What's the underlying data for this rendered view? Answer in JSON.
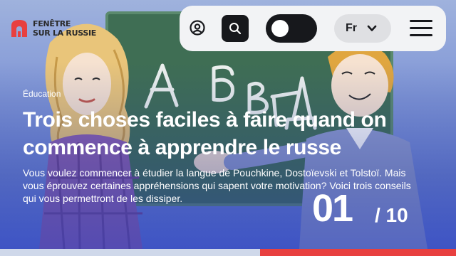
{
  "header": {
    "logo_line1": "Fenêtre",
    "logo_line2": "sur la Russie",
    "language": "Fr"
  },
  "icons": {
    "user": "user-circle-icon",
    "search": "search-icon",
    "theme": "theme-toggle",
    "chevron": "chevron-down-icon",
    "menu": "hamburger-menu-icon"
  },
  "hero": {
    "category": "Éducation",
    "title": "Trois choses faciles à faire quand on commence à apprendre le russe",
    "description": "Vous voulez commencer à étudier la langue de Pouchkine, Dostoïevski et Tolstoï. Mais vous éprouvez certaines appréhensions qui sapent votre motivation? Voici trois conseils qui vous permettront de les dissiper.",
    "chalkboard_letters": "АБВГД",
    "slide_current": "01",
    "slide_total": "/ 10"
  },
  "colors": {
    "brand_red": "#e8403f",
    "nav_bg": "#f2f3f5",
    "dark": "#17181c"
  }
}
